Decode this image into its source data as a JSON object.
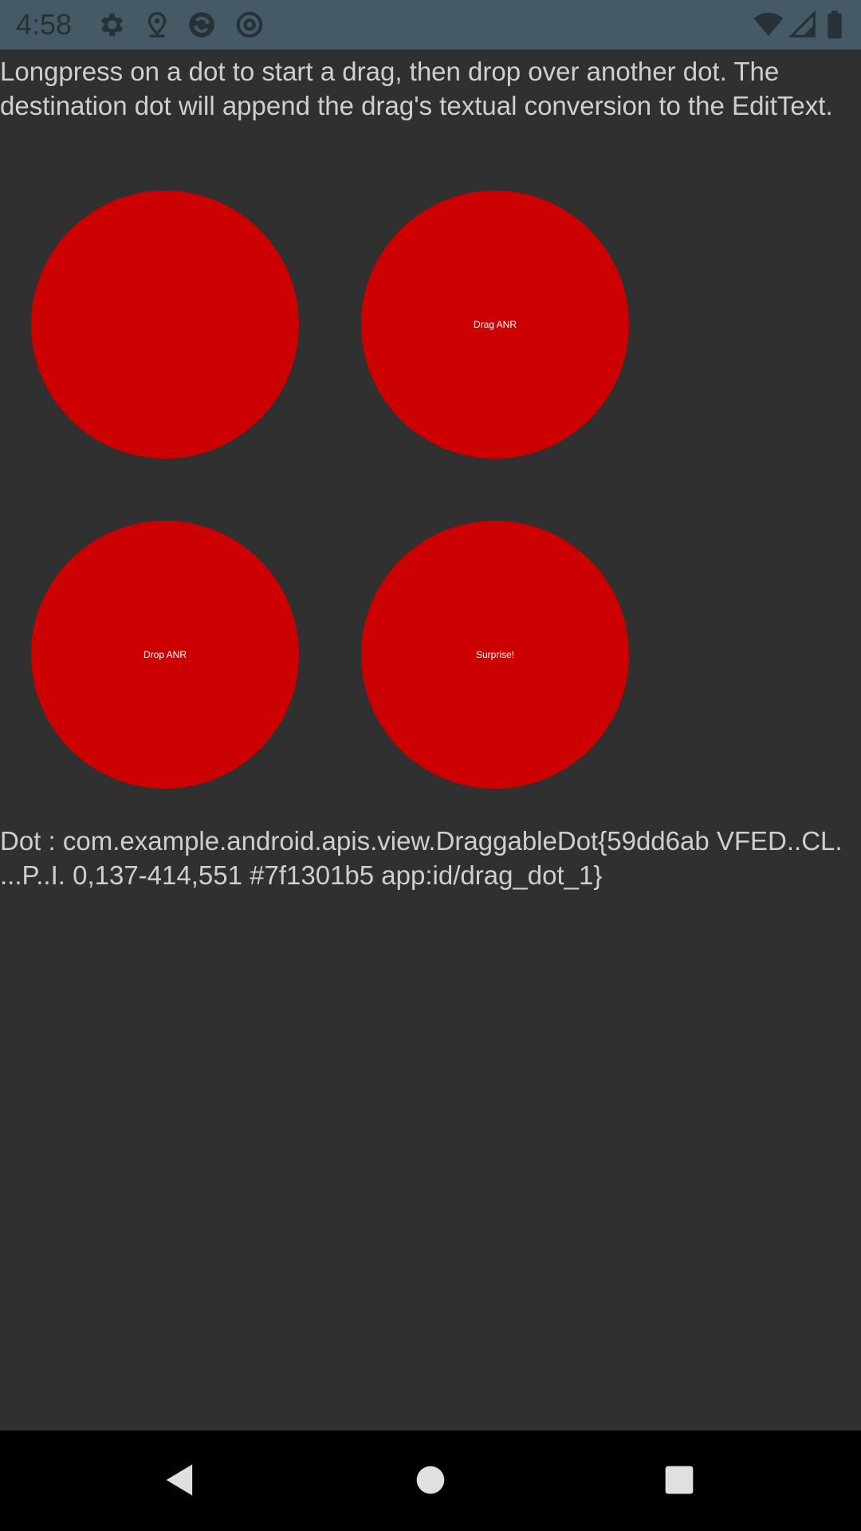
{
  "status_bar": {
    "time": "4:58",
    "icons_left": [
      "settings-icon",
      "location-icon",
      "sync-icon",
      "at-icon"
    ],
    "icons_right": [
      "wifi-icon",
      "signal-icon",
      "battery-icon"
    ]
  },
  "instructions": {
    "text": "Longpress on a dot to start a drag, then drop over another dot. The destination dot will append the drag's textual conversion to the EditText."
  },
  "dots": [
    {
      "label": ""
    },
    {
      "label": "Drag ANR"
    },
    {
      "label": "Drop ANR"
    },
    {
      "label": "Surprise!"
    }
  ],
  "output": {
    "text": "Dot : com.example.android.apis.view.DraggableDot{59dd6ab VFED..CL. ...P..I. 0,137-414,551 #7f1301b5 app:id/drag_dot_1}"
  },
  "nav_bar": {
    "buttons": [
      "back-icon",
      "home-icon",
      "recents-icon"
    ]
  },
  "colors": {
    "status_bar": "#455a64",
    "background": "#303030",
    "dot": "#cc0000",
    "text": "#cfcfcf",
    "nav_bar": "#000000"
  }
}
